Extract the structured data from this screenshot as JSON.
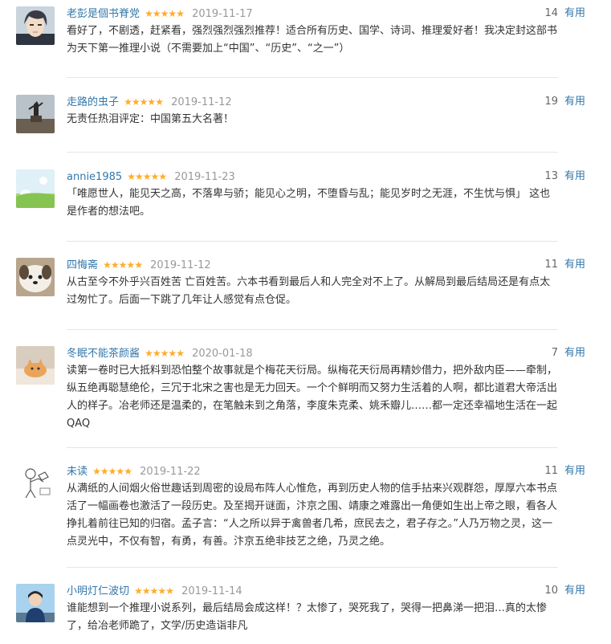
{
  "comments": [
    {
      "user": "老彭是個书脊党",
      "stars": "★★★★★",
      "date": "2019-11-17",
      "votes": "14",
      "useful_label": "有用",
      "text": "看好了，不剧透，赶紧看，强烈强烈强烈推荐！适合所有历史、国学、诗词、推理爱好者！我决定封这部书为天下第一推理小说（不需要加上“中国”、“历史”、“之一”）",
      "avatar": "anime-portrait-icon"
    },
    {
      "user": "走路的虫子",
      "stars": "★★★★★",
      "date": "2019-11-12",
      "votes": "19",
      "useful_label": "有用",
      "text": "无责任热泪评定：中国第五大名著！",
      "avatar": "statue-photo-icon"
    },
    {
      "user": "annie1985",
      "stars": "★★★★★",
      "date": "2019-11-23",
      "votes": "13",
      "useful_label": "有用",
      "text": "「唯愿世人，能见天之高，不落卑与骄；能见心之明，不堕昏与乱；能见岁时之无涯，不生忧与惧」 这也是作者的想法吧。",
      "avatar": "green-landscape-icon"
    },
    {
      "user": "四悔斋",
      "stars": "★★★★★",
      "date": "2019-11-12",
      "votes": "11",
      "useful_label": "有用",
      "text": "从古至今不外乎兴百姓苦 亡百姓苦。六本书看到最后人和人完全对不上了。从解局到最后结局还是有点太过匆忙了。后面一下跳了几年让人感觉有点仓促。",
      "avatar": "puppy-photo-icon"
    },
    {
      "user": "冬眠不能茶颜酱",
      "stars": "★★★★★",
      "date": "2020-01-18",
      "votes": "7",
      "useful_label": "有用",
      "text": "读第一卷时已大抵料到恐怕整个故事就是个梅花天衍局。纵梅花天衍局再精妙借力，把外敌内臣——牵制，纵五绝再聪慧绝伦，三冗于北宋之害也是无力回天。一个个鲜明而又努力生活着的人啊，都比道君大帝活出人的样子。冶老师还是温柔的，在笔触未到之角落，李度朱克柔、姚禾瓣儿……都一定还幸福地生活在一起QAQ",
      "avatar": "cat-photo-icon"
    },
    {
      "user": "未读",
      "stars": "★★★★★",
      "date": "2019-11-22",
      "votes": "11",
      "useful_label": "有用",
      "text": "从满纸的人间烟火俗世趣话到周密的设局布阵人心惟危，再到历史人物的信手拈来兴观群怨，厚厚六本书点活了一幅画卷也激活了一段历史。及至揭开谜面，汴京之围、靖康之难露出一角便如生出上帝之眼，看各人挣扎着前往已知的归宿。孟子言：“人之所以异于禽兽者几希，庶民去之，君子存之。”人乃万物之灵，这一点灵光中，不仅有智，有勇，有善。汴京五绝非技艺之绝，乃灵之绝。",
      "avatar": "sketch-figure-icon"
    },
    {
      "user": "小明灯仁波切",
      "stars": "★★★★★",
      "date": "2019-11-14",
      "votes": "10",
      "useful_label": "有用",
      "text": "谁能想到一个推理小说系列，最后结局会成这样！？太惨了，哭死我了，哭得一把鼻涕一把泪…真的太惨了，给冶老师跪了，文学/历史造诣非凡",
      "avatar": "person-photo-icon"
    }
  ]
}
